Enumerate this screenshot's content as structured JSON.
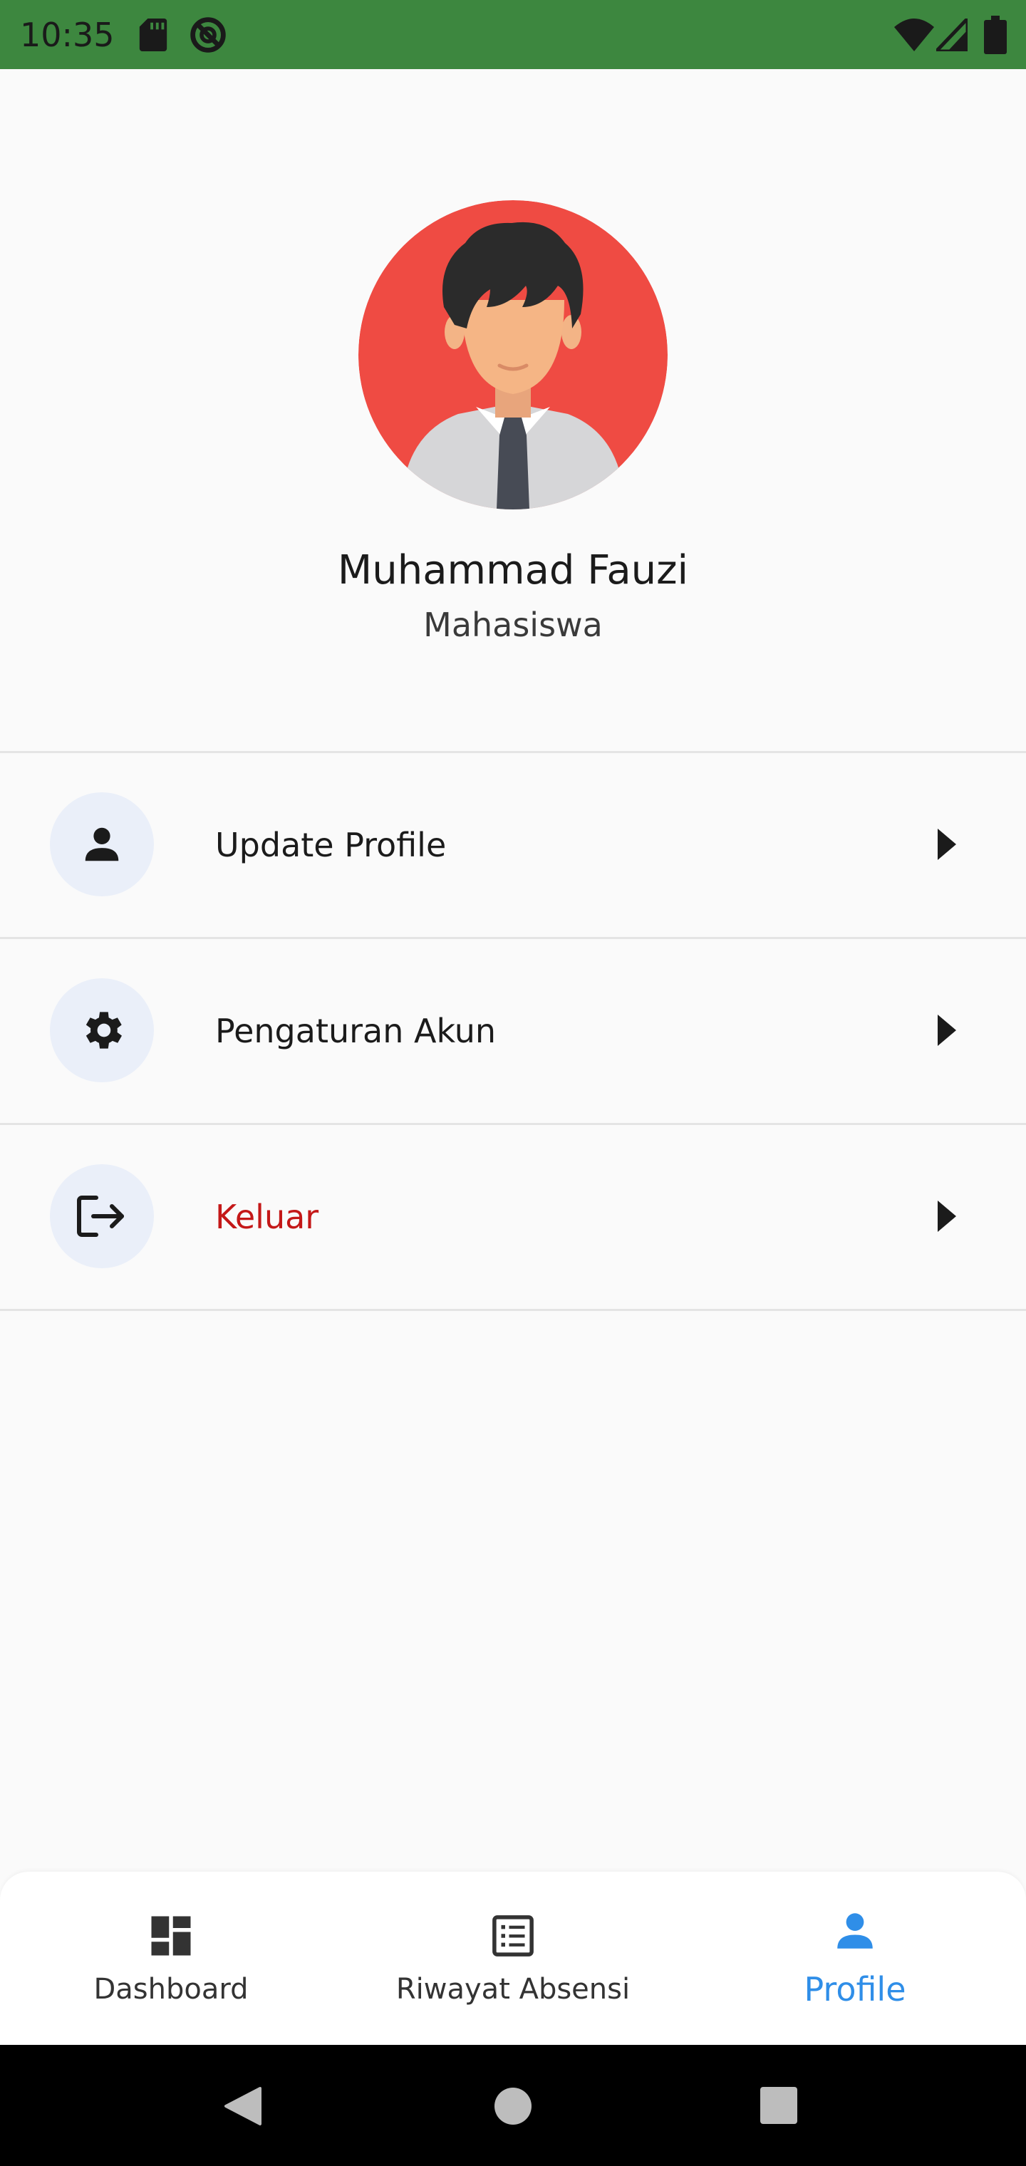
{
  "status_bar": {
    "time": "10:35",
    "color": "#3d873f",
    "icons": [
      "sd-card-icon",
      "sync-disabled-icon",
      "wifi-icon",
      "signal-icon",
      "battery-icon"
    ]
  },
  "profile": {
    "name": "Muhammad Fauzi",
    "role": "Mahasiswa",
    "avatar_bg": "#ef4b43"
  },
  "menu": {
    "items": [
      {
        "label": "Update Profile",
        "icon": "person-icon",
        "danger": false
      },
      {
        "label": "Pengaturan Akun",
        "icon": "gear-icon",
        "danger": false
      },
      {
        "label": "Keluar",
        "icon": "logout-icon",
        "danger": true
      }
    ]
  },
  "bottom_nav": {
    "items": [
      {
        "label": "Dashboard",
        "icon": "dashboard-icon",
        "active": false
      },
      {
        "label": "Riwayat Absensi",
        "icon": "list-icon",
        "active": false
      },
      {
        "label": "Profile",
        "icon": "person-icon",
        "active": true
      }
    ],
    "active_color": "#2f8ee8"
  },
  "system_nav": {
    "buttons": [
      "back-icon",
      "home-icon",
      "recents-icon"
    ]
  }
}
